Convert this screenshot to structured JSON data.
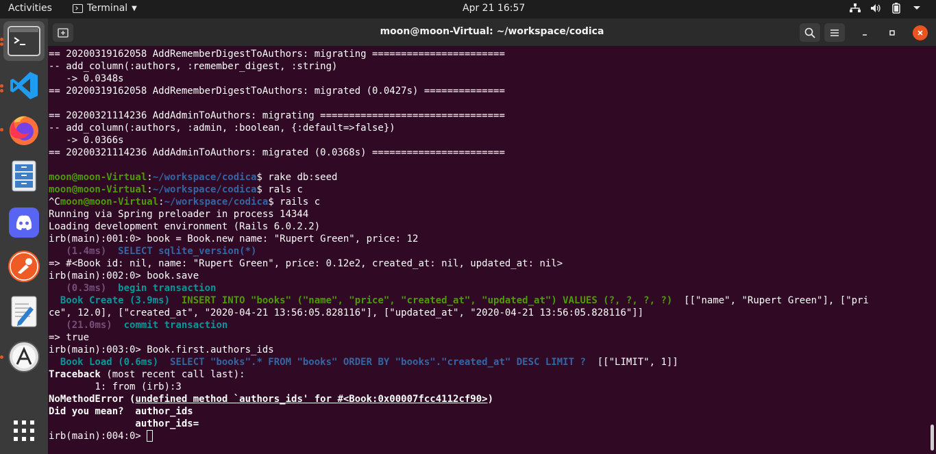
{
  "topbar": {
    "activities": "Activities",
    "app_name": "Terminal",
    "clock": "Apr 21  16:57",
    "tray_icons": [
      "network-icon",
      "volume-icon",
      "battery-icon",
      "power-menu-icon"
    ]
  },
  "dock": {
    "items": [
      {
        "name": "terminal",
        "icon": "terminal-icon",
        "running": true,
        "active": true
      },
      {
        "name": "vscode",
        "icon": "vscode-icon",
        "running": true
      },
      {
        "name": "firefox",
        "icon": "firefox-icon",
        "running": true
      },
      {
        "name": "files",
        "icon": "files-icon"
      },
      {
        "name": "discord",
        "icon": "discord-icon"
      },
      {
        "name": "postman",
        "icon": "postman-icon"
      },
      {
        "name": "text-editor",
        "icon": "text-editor-icon"
      },
      {
        "name": "software",
        "icon": "software-center-icon",
        "running": true
      },
      {
        "name": "show-apps",
        "icon": "app-grid-icon"
      }
    ]
  },
  "window": {
    "title": "moon@moon-Virtual: ~/workspace/codica",
    "buttons": [
      "new-tab",
      "search",
      "menu",
      "minimize",
      "maximize",
      "close"
    ]
  },
  "terminal": {
    "prompt_user": "moon@moon-Virtual",
    "prompt_path": "~/workspace/codica",
    "lines": [
      [
        {
          "t": "== 20200319162058 AddRememberDigestToAuthors: migrating ======================="
        }
      ],
      [
        {
          "t": "-- add_column(:authors, :remember_digest, :string)"
        }
      ],
      [
        {
          "t": "   -> 0.0348s"
        }
      ],
      [
        {
          "t": "== 20200319162058 AddRememberDigestToAuthors: migrated (0.0427s) =============="
        }
      ],
      [
        {
          "t": ""
        }
      ],
      [
        {
          "t": "== 20200321114236 AddAdminToAuthors: migrating ================================"
        }
      ],
      [
        {
          "t": "-- add_column(:authors, :admin, :boolean, {:default=>false})"
        }
      ],
      [
        {
          "t": "   -> 0.0366s"
        }
      ],
      [
        {
          "t": "== 20200321114236 AddAdminToAuthors: migrated (0.0368s) ======================="
        }
      ],
      [
        {
          "t": ""
        }
      ],
      [
        {
          "t": "moon@moon-Virtual",
          "c": "g"
        },
        {
          "t": ":"
        },
        {
          "t": "~/workspace/codica",
          "c": "b"
        },
        {
          "t": "$ rake db:seed"
        }
      ],
      [
        {
          "t": "moon@moon-Virtual",
          "c": "g"
        },
        {
          "t": ":"
        },
        {
          "t": "~/workspace/codica",
          "c": "b"
        },
        {
          "t": "$ rals c"
        }
      ],
      [
        {
          "t": "^C"
        },
        {
          "t": "moon@moon-Virtual",
          "c": "g"
        },
        {
          "t": ":"
        },
        {
          "t": "~/workspace/codica",
          "c": "b"
        },
        {
          "t": "$ rails c"
        }
      ],
      [
        {
          "t": "Running via Spring preloader in process 14344"
        }
      ],
      [
        {
          "t": "Loading development environment (Rails 6.0.2.2)"
        }
      ],
      [
        {
          "t": "irb(main):001:0> book = Book.new name: \"Rupert Green\", price: 12"
        }
      ],
      [
        {
          "t": "   "
        },
        {
          "t": "(1.4ms)",
          "c": "m"
        },
        {
          "t": "  "
        },
        {
          "t": "SELECT sqlite_version(*)",
          "c": "b"
        }
      ],
      [
        {
          "t": "=> #<Book id: nil, name: \"Rupert Green\", price: 0.12e2, created_at: nil, updated_at: nil>"
        }
      ],
      [
        {
          "t": "irb(main):002:0> book.save"
        }
      ],
      [
        {
          "t": "   "
        },
        {
          "t": "(0.3ms)",
          "c": "m"
        },
        {
          "t": "  "
        },
        {
          "t": "begin transaction",
          "c": "c"
        }
      ],
      [
        {
          "t": "  "
        },
        {
          "t": "Book Create (3.9ms)",
          "c": "c"
        },
        {
          "t": "  "
        },
        {
          "t": "INSERT INTO \"books\" (\"name\", \"price\", \"created_at\", \"updated_at\") VALUES (?, ?, ?, ?)",
          "c": "g"
        },
        {
          "t": "  [[\"name\", \"Rupert Green\"], [\"pri"
        }
      ],
      [
        {
          "t": "ce\", 12.0], [\"created_at\", \"2020-04-21 13:56:05.828116\"], [\"updated_at\", \"2020-04-21 13:56:05.828116\"]]"
        }
      ],
      [
        {
          "t": "   "
        },
        {
          "t": "(21.0ms)",
          "c": "m"
        },
        {
          "t": "  "
        },
        {
          "t": "commit transaction",
          "c": "c"
        }
      ],
      [
        {
          "t": "=> true"
        }
      ],
      [
        {
          "t": "irb(main):003:0> Book.first.authors_ids"
        }
      ],
      [
        {
          "t": "  "
        },
        {
          "t": "Book Load (0.6ms)",
          "c": "c"
        },
        {
          "t": "  "
        },
        {
          "t": "SELECT \"books\".* FROM \"books\" ORDER BY \"books\".\"created_at\" DESC LIMIT ?",
          "c": "b"
        },
        {
          "t": "  [[\"LIMIT\", 1]]"
        }
      ],
      [
        {
          "t": "Traceback",
          "c": "bd"
        },
        {
          "t": " (most recent call last):"
        }
      ],
      [
        {
          "t": "        1: from (irb):3"
        }
      ],
      [
        {
          "t": "NoMethodError (",
          "c": "bd"
        },
        {
          "t": "undefined method `authors_ids' for #<Book:0x00007fcc4112cf90>",
          "c": "u"
        },
        {
          "t": ")",
          "c": "bd"
        }
      ],
      [
        {
          "t": "Did you mean?  author_ids",
          "c": "bd"
        }
      ],
      [
        {
          "t": "               author_ids=",
          "c": "bd"
        }
      ],
      [
        {
          "t": "irb(main):004:0> "
        },
        {
          "cursor": true
        }
      ]
    ]
  }
}
